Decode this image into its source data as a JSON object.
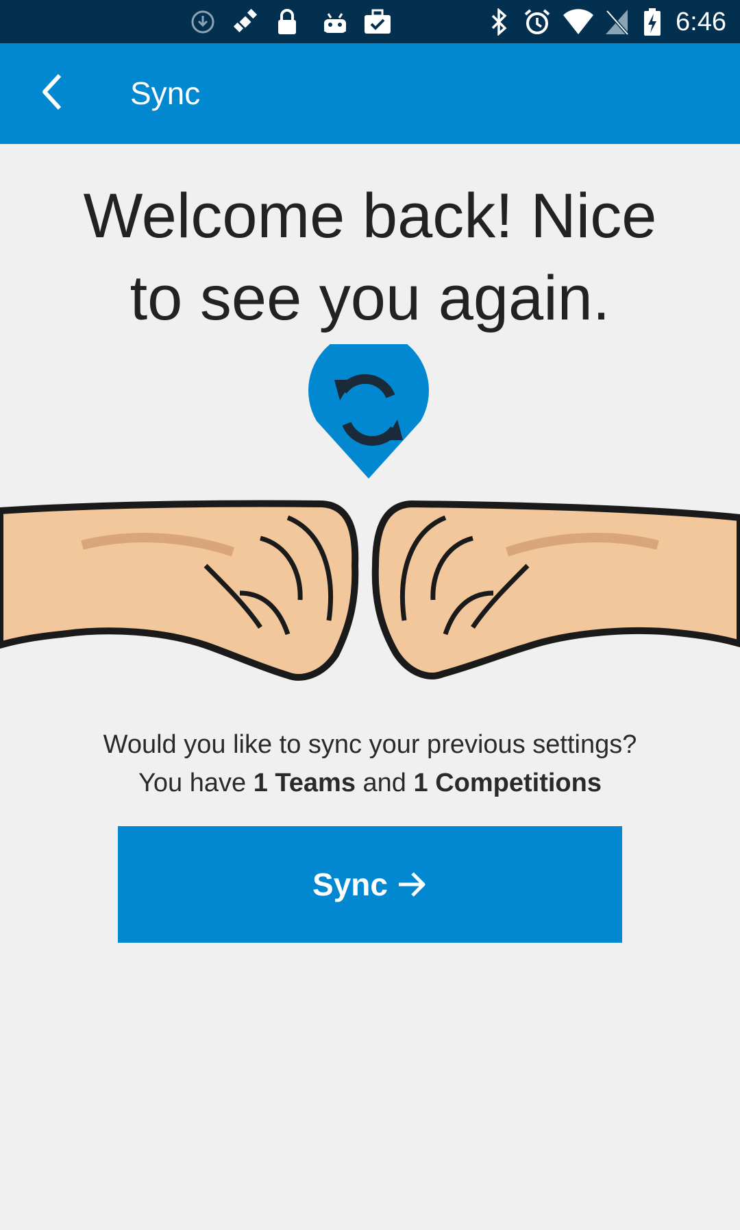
{
  "status_bar": {
    "time": "6:46",
    "icons": [
      "download-icon",
      "satellite-icon",
      "lock-icon",
      "android-icon",
      "briefcase-check-icon",
      "bluetooth-icon",
      "alarm-icon",
      "wifi-icon",
      "no-sim-icon",
      "battery-charging-icon"
    ]
  },
  "toolbar": {
    "title": "Sync",
    "back_icon": "chevron-left-icon"
  },
  "welcome": {
    "line1": "Welcome back! Nice",
    "line2": "to see you again."
  },
  "message": {
    "line1": "Would you like to sync your previous settings?",
    "prefix": "You have ",
    "teams": "1 Teams",
    "middle": " and ",
    "competitions": "1 Competitions"
  },
  "sync_button": {
    "label": "Sync",
    "icon": "arrow-right-icon"
  },
  "colors": {
    "primary": "#0288d1",
    "status_bar": "#04304f",
    "background": "#f0f0f0"
  }
}
